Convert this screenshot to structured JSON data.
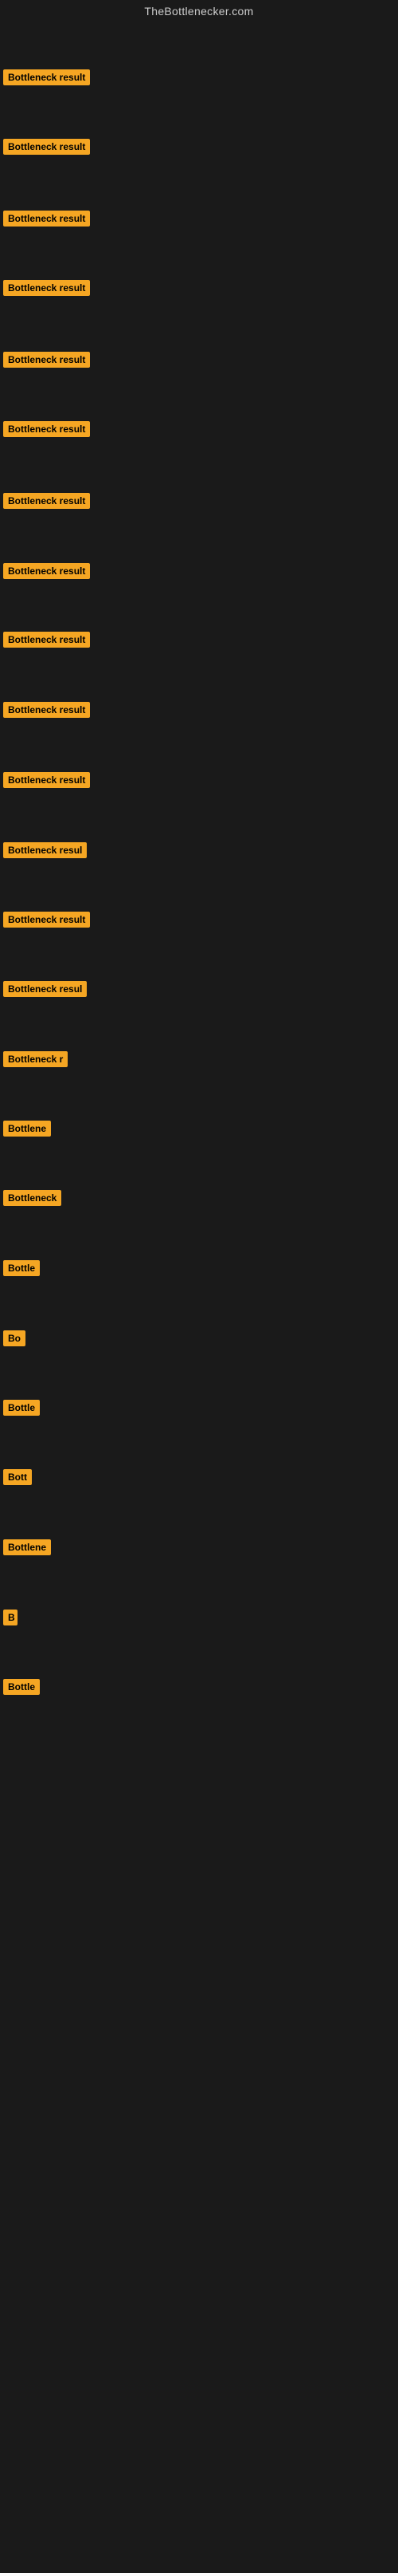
{
  "site": {
    "title": "TheBottlenecker.com"
  },
  "badges": [
    {
      "id": 1,
      "label": "Bottleneck result",
      "visible_text": "Bottleneck result"
    },
    {
      "id": 2,
      "label": "Bottleneck result",
      "visible_text": "Bottleneck result"
    },
    {
      "id": 3,
      "label": "Bottleneck result",
      "visible_text": "Bottleneck result"
    },
    {
      "id": 4,
      "label": "Bottleneck result",
      "visible_text": "Bottleneck result"
    },
    {
      "id": 5,
      "label": "Bottleneck result",
      "visible_text": "Bottleneck result"
    },
    {
      "id": 6,
      "label": "Bottleneck result",
      "visible_text": "Bottleneck result"
    },
    {
      "id": 7,
      "label": "Bottleneck result",
      "visible_text": "Bottleneck result"
    },
    {
      "id": 8,
      "label": "Bottleneck result",
      "visible_text": "Bottleneck result"
    },
    {
      "id": 9,
      "label": "Bottleneck result",
      "visible_text": "Bottleneck result"
    },
    {
      "id": 10,
      "label": "Bottleneck result",
      "visible_text": "Bottleneck result"
    },
    {
      "id": 11,
      "label": "Bottleneck result",
      "visible_text": "Bottleneck result"
    },
    {
      "id": 12,
      "label": "Bottleneck resul",
      "visible_text": "Bottleneck resul"
    },
    {
      "id": 13,
      "label": "Bottleneck result",
      "visible_text": "Bottleneck result"
    },
    {
      "id": 14,
      "label": "Bottleneck resul",
      "visible_text": "Bottleneck resul"
    },
    {
      "id": 15,
      "label": "Bottleneck r",
      "visible_text": "Bottleneck r"
    },
    {
      "id": 16,
      "label": "Bottlene",
      "visible_text": "Bottlene"
    },
    {
      "id": 17,
      "label": "Bottleneck",
      "visible_text": "Bottleneck"
    },
    {
      "id": 18,
      "label": "Bottle",
      "visible_text": "Bottle"
    },
    {
      "id": 19,
      "label": "Bo",
      "visible_text": "Bo"
    },
    {
      "id": 20,
      "label": "Bottle",
      "visible_text": "Bottle"
    },
    {
      "id": 21,
      "label": "Bott",
      "visible_text": "Bott"
    },
    {
      "id": 22,
      "label": "Bottlene",
      "visible_text": "Bottlene"
    },
    {
      "id": 23,
      "label": "B",
      "visible_text": "B"
    },
    {
      "id": 24,
      "label": "Bottle",
      "visible_text": "Bottle"
    }
  ],
  "colors": {
    "badge_bg": "#f5a623",
    "badge_text": "#000000",
    "background": "#1a1a1a",
    "site_title": "#cccccc"
  }
}
